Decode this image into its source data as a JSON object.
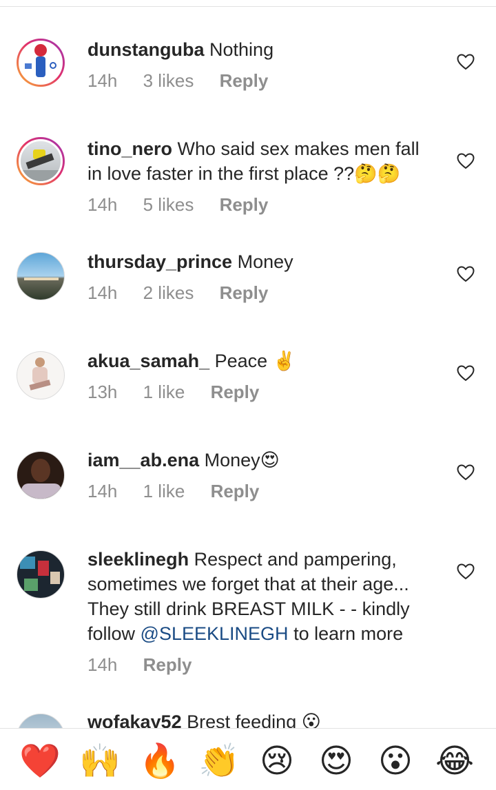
{
  "comments": [
    {
      "user": "dunstanguba",
      "text": "Nothing",
      "time": "14h",
      "likes": "3 likes",
      "reply": "Reply"
    },
    {
      "user": "tino_nero",
      "text": "Who said sex makes men fall in love faster in the first place ??",
      "emoji": "🤔🤔",
      "time": "14h",
      "likes": "5 likes",
      "reply": "Reply"
    },
    {
      "user": "thursday_prince",
      "text": "Money",
      "time": "14h",
      "likes": "2 likes",
      "reply": "Reply"
    },
    {
      "user": "akua_samah_",
      "text": "Peace",
      "emoji": "✌️",
      "time": "13h",
      "likes": "1 like",
      "reply": "Reply"
    },
    {
      "user": "iam__ab.ena",
      "text": "Money",
      "emoji": "😍",
      "time": "14h",
      "likes": "1 like",
      "reply": "Reply"
    },
    {
      "user": "sleeklinegh",
      "text": "Respect and pampering, sometimes  we forget that at their age... They still drink BREAST MILK - - kindly follow",
      "mention": "@SLEEKLINEGH",
      "text_after": "to learn more",
      "time": "14h",
      "reply": "Reply"
    },
    {
      "user": "wofakay52",
      "text": "Brest feeding",
      "emoji": "😮"
    }
  ],
  "reactions": [
    "❤️",
    "🙌",
    "🔥",
    "👏",
    "😢",
    "😍",
    "😮",
    "😂"
  ],
  "colors": {
    "mention": "#1a4b84",
    "meta": "#8e8e8e",
    "ring_start": "#f9b233",
    "ring_end": "#9b36b7"
  }
}
